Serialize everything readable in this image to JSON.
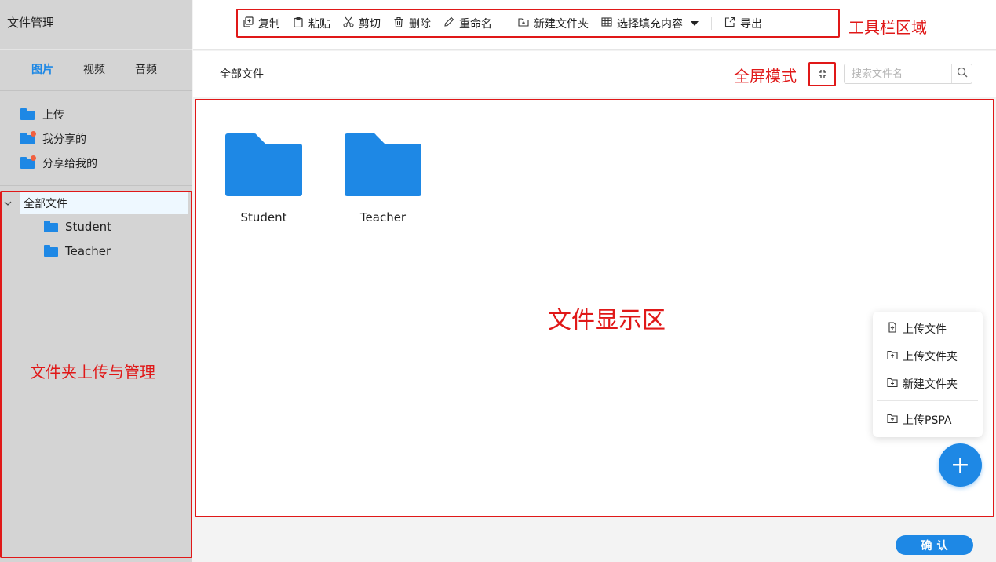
{
  "sidebar": {
    "title": "文件管理",
    "tabs": [
      {
        "label": "图片",
        "active": true
      },
      {
        "label": "视频",
        "active": false
      },
      {
        "label": "音频",
        "active": false
      }
    ],
    "groups": [
      {
        "label": "上传",
        "icon": "folder-icon"
      },
      {
        "label": "我分享的",
        "icon": "shared-folder-icon"
      },
      {
        "label": "分享给我的",
        "icon": "shared-with-me-folder-icon"
      }
    ],
    "tree": {
      "root": "全部文件",
      "children": [
        "Student",
        "Teacher"
      ]
    }
  },
  "toolbar": {
    "copy": "复制",
    "paste": "粘贴",
    "cut": "剪切",
    "delete": "删除",
    "rename": "重命名",
    "new_folder": "新建文件夹",
    "select_fill": "选择填充内容",
    "export": "导出"
  },
  "breadcrumb": "全部文件",
  "search": {
    "placeholder": "搜索文件名"
  },
  "files": [
    "Student",
    "Teacher"
  ],
  "fab_menu": {
    "upload_file": "上传文件",
    "upload_folder": "上传文件夹",
    "new_folder": "新建文件夹",
    "upload_pspa": "上传PSPA"
  },
  "fab_label": "+",
  "confirm": "确认",
  "annotations": {
    "toolbar": "工具栏区域",
    "fullscreen": "全屏模式",
    "file_area": "文件显示区",
    "folder_area": "文件夹上传与管理"
  },
  "colors": {
    "accent": "#1e88e5",
    "annotation": "#e01818",
    "sidebar_bg": "#d4d4d4"
  }
}
